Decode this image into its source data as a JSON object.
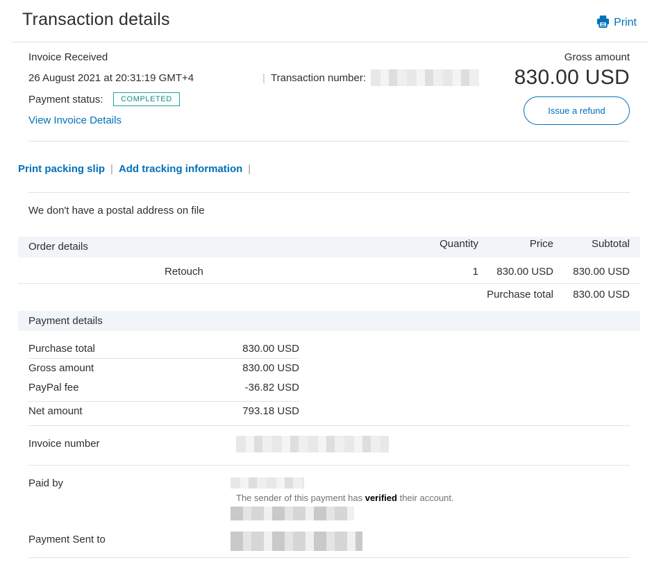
{
  "header": {
    "title": "Transaction details",
    "print_label": "Print",
    "print_icon": "printer-icon"
  },
  "summary": {
    "type_label": "Invoice Received",
    "datetime": "26 August 2021 at 20:31:19 GMT+4",
    "transaction_number_label": "Transaction number:",
    "payment_status_label": "Payment status:",
    "payment_status": "COMPLETED",
    "view_invoice_link": "View Invoice Details",
    "gross_label": "Gross amount",
    "gross_amount": "830.00 USD",
    "refund_button": "Issue a refund"
  },
  "actions": {
    "packing_slip": "Print packing slip",
    "tracking": "Add tracking information",
    "separator": "|"
  },
  "address": {
    "text": "We don't have a postal address on file"
  },
  "order": {
    "heading": "Order details",
    "columns": {
      "quantity": "Quantity",
      "price": "Price",
      "subtotal": "Subtotal"
    },
    "items": [
      {
        "name": "Retouch",
        "quantity": "1",
        "price": "830.00 USD",
        "subtotal": "830.00 USD"
      }
    ],
    "purchase_total_label": "Purchase total",
    "purchase_total": "830.00 USD"
  },
  "payment": {
    "heading": "Payment details",
    "rows": [
      {
        "label": "Purchase total",
        "value": "830.00 USD"
      },
      {
        "label": "Gross amount",
        "value": "830.00 USD"
      },
      {
        "label": "PayPal fee",
        "value": "-36.82 USD"
      },
      {
        "label": "Net amount",
        "value": "793.18 USD"
      }
    ],
    "invoice_number_label": "Invoice number",
    "paid_by_label": "Paid by",
    "verified_prefix": "The sender of this payment has ",
    "verified_word": "verified",
    "verified_suffix": " their account.",
    "sent_to_label": "Payment Sent to"
  },
  "colors": {
    "link": "#0070ba",
    "badge": "#1fa39a",
    "band": "#f1f5f9"
  }
}
